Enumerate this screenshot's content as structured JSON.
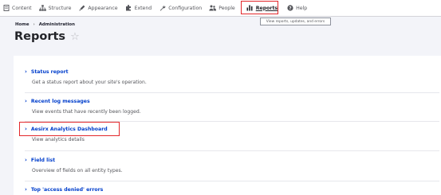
{
  "toolbar": {
    "items": [
      {
        "label": "Content",
        "icon": "content-icon"
      },
      {
        "label": "Structure",
        "icon": "structure-icon"
      },
      {
        "label": "Appearance",
        "icon": "appearance-icon"
      },
      {
        "label": "Extend",
        "icon": "extend-icon"
      },
      {
        "label": "Configuration",
        "icon": "configuration-icon"
      },
      {
        "label": "People",
        "icon": "people-icon"
      },
      {
        "label": "Reports",
        "icon": "reports-icon"
      },
      {
        "label": "Help",
        "icon": "help-icon"
      }
    ],
    "tooltip": "View reports, updates, and errors"
  },
  "breadcrumb": {
    "home": "Home",
    "sep": "›",
    "admin": "Administration"
  },
  "page": {
    "title": "Reports",
    "star": "☆"
  },
  "items": [
    {
      "link": "Status report",
      "desc": "Get a status report about your site's operation."
    },
    {
      "link": "Recent log messages",
      "desc": "View events that have recently been logged."
    },
    {
      "link": "Aesirx Analytics Dashboard",
      "desc": "View analytics details"
    },
    {
      "link": "Field list",
      "desc": "Overview of fields on all entity types."
    },
    {
      "link": "Top 'access denied' errors",
      "desc": ""
    }
  ],
  "colors": {
    "accent": "#003ecc",
    "highlight": "#e3272b",
    "background": "#f3f4f9"
  }
}
